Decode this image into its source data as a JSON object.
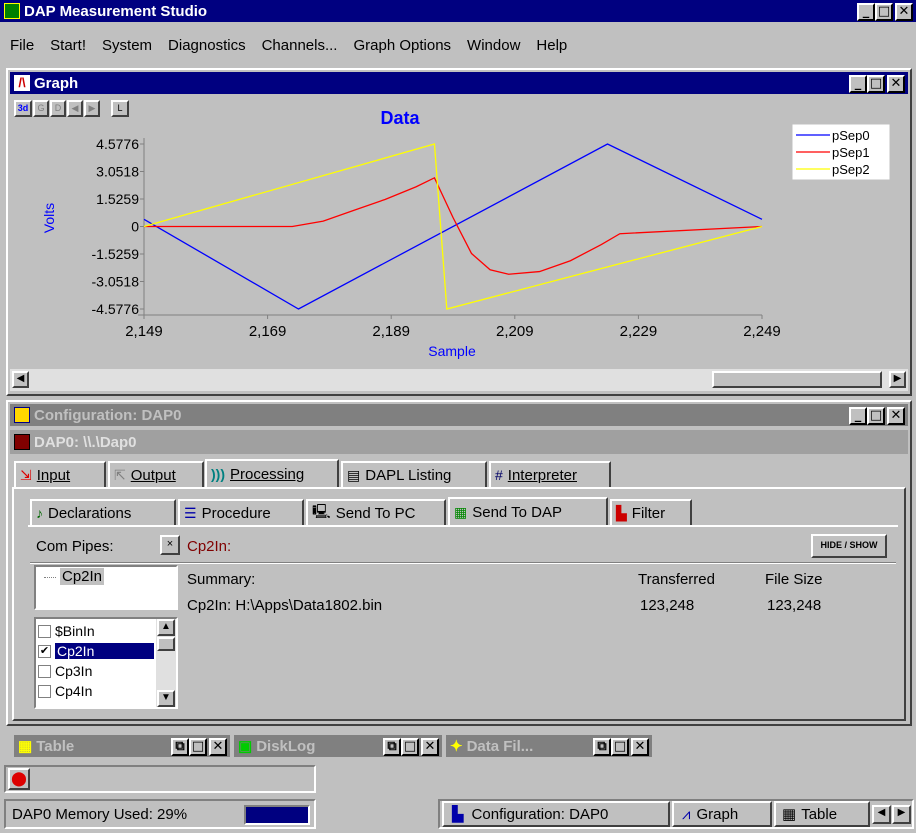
{
  "app": {
    "title": "DAP Measurement Studio",
    "menu": [
      "File",
      "Start!",
      "System",
      "Diagnostics",
      "Channels...",
      "Graph Options",
      "Window",
      "Help"
    ]
  },
  "graph_window": {
    "title": "Graph",
    "toolbar": [
      "3d",
      "G",
      "D",
      "◀",
      "▶",
      "L"
    ],
    "chart_data": {
      "type": "line",
      "title": "Data",
      "xlabel": "Sample",
      "ylabel": "Volts",
      "x_ticks": [
        "2,149",
        "2,169",
        "2,189",
        "2,209",
        "2,229",
        "2,249"
      ],
      "y_ticks": [
        "4.5776",
        "3.0518",
        "1.5259",
        "0",
        "-1.5259",
        "-3.0518",
        "-4.5776"
      ],
      "xlim": [
        2149,
        2249
      ],
      "ylim": [
        -4.5776,
        4.5776
      ],
      "grid": false,
      "legend_position": "top-right",
      "series": [
        {
          "name": "pSep0",
          "color": "#0000ff",
          "x": [
            2149,
            2174,
            2224,
            2249
          ],
          "y": [
            0.4,
            -4.5776,
            4.5776,
            0.4
          ]
        },
        {
          "name": "pSep1",
          "color": "#ff0000",
          "x": [
            2149,
            2173,
            2178,
            2183,
            2188,
            2193,
            2196,
            2199,
            2202,
            2205,
            2208,
            2213,
            2218,
            2223,
            2226,
            2249
          ],
          "y": [
            0,
            0,
            0.3,
            0.9,
            1.5,
            2.2,
            2.7,
            0.5,
            -1.5,
            -2.4,
            -2.65,
            -2.5,
            -1.9,
            -1.0,
            -0.4,
            0
          ]
        },
        {
          "name": "pSep2",
          "color": "#ffff00",
          "x": [
            2149,
            2196,
            2198,
            2249
          ],
          "y": [
            0,
            4.5776,
            -4.5776,
            0
          ]
        }
      ]
    }
  },
  "config_window": {
    "title": "Configuration: DAP0",
    "subtitle": "DAP0: \\\\.\\Dap0",
    "main_tabs": [
      "Input",
      "Output",
      "Processing",
      "DAPL Listing",
      "Interpreter"
    ],
    "sub_tabs": [
      "Declarations",
      "Procedure",
      "Send To PC",
      "Send To DAP",
      "Filter"
    ],
    "com_pipes_label": "Com Pipes:",
    "current_pipe": "Cp2In:",
    "hide_show": "HIDE / SHOW",
    "tree_item": "Cp2In",
    "pipes": [
      {
        "name": "$BinIn",
        "checked": false
      },
      {
        "name": "Cp2In",
        "checked": true
      },
      {
        "name": "Cp3In",
        "checked": false
      },
      {
        "name": "Cp4In",
        "checked": false
      }
    ],
    "summary_headers": [
      "Summary:",
      "Transferred",
      "File Size"
    ],
    "summary_row": {
      "summary": "Cp2In: H:\\Apps\\Data1802.bin",
      "transferred": "123,248",
      "file_size": "123,248"
    }
  },
  "minimized": [
    "Table",
    "DiskLog",
    "Data Fil..."
  ],
  "status": {
    "memory": "DAP0 Memory Used:  29%",
    "memory_percent": 29,
    "task_tabs": [
      "Configuration: DAP0",
      "Graph",
      "Table"
    ]
  },
  "colors": {
    "title_active": "#000080",
    "title_inactive": "#808080",
    "face": "#c0c0c0"
  }
}
